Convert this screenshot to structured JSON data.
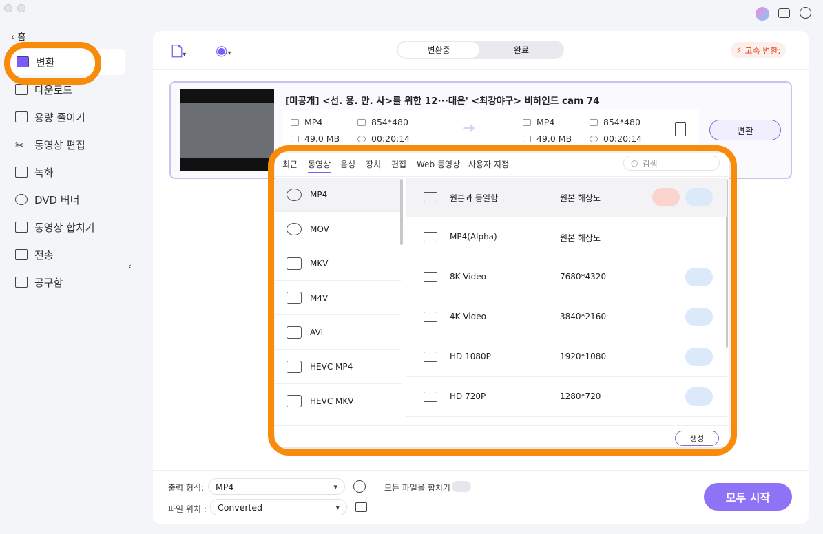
{
  "sidebar": {
    "home": "홈",
    "items": [
      {
        "label": "변환"
      },
      {
        "label": "다운로드"
      },
      {
        "label": "용량 줄이기"
      },
      {
        "label": "동영상 편집"
      },
      {
        "label": "녹화"
      },
      {
        "label": "DVD 버너"
      },
      {
        "label": "동영상 합치기"
      },
      {
        "label": "전송"
      },
      {
        "label": "공구함"
      }
    ]
  },
  "toolbar": {
    "tabs": [
      "변환중",
      "완료"
    ],
    "fast": "고속 변환:"
  },
  "file": {
    "title": "[미공개] <선. 용. 만. 사>를 위한 12···대은'  <최강야구> 비하인드 cam 74",
    "src": {
      "format": "MP4",
      "res": "854*480",
      "size": "49.0 MB",
      "dur": "00:20:14"
    },
    "dst": {
      "format": "MP4",
      "res": "854*480",
      "size": "49.0 MB",
      "dur": "00:20:14"
    },
    "convert": "변환"
  },
  "popup": {
    "tabs": [
      "최근",
      "동영상",
      "음성",
      "장치",
      "편집",
      "Web 동영상",
      "사용자 지정"
    ],
    "search_placeholder": "검색",
    "formats": [
      "MP4",
      "MOV",
      "MKV",
      "M4V",
      "AVI",
      "HEVC MP4",
      "HEVC MKV"
    ],
    "presets": [
      {
        "name": "원본과 동일함",
        "res": "원본 해상도"
      },
      {
        "name": "MP4(Alpha)",
        "res": "원본 해상도"
      },
      {
        "name": "8K Video",
        "res": "7680*4320"
      },
      {
        "name": "4K Video",
        "res": "3840*2160"
      },
      {
        "name": "HD 1080P",
        "res": "1920*1080"
      },
      {
        "name": "HD 720P",
        "res": "1280*720"
      }
    ],
    "create": "생성"
  },
  "bottom": {
    "out_label": "출력 형식:",
    "out_value": "MP4",
    "loc_label": "파일 위치 :",
    "loc_value": "Converted",
    "merge": "모든 파일을 합치기",
    "start": "모두 시작"
  },
  "colors": {
    "accent": "#8f73f7",
    "highlight": "#f98b0b"
  }
}
